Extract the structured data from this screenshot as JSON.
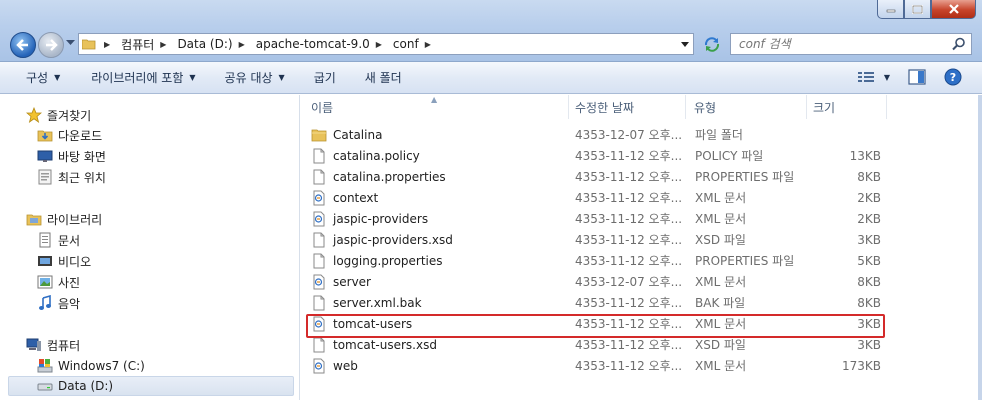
{
  "address": {
    "crumbs": [
      "컴퓨터",
      "Data (D:)",
      "apache-tomcat-9.0",
      "conf"
    ]
  },
  "search": {
    "placeholder": "conf 검색"
  },
  "commands": {
    "organize": "구성",
    "include_library": "라이브러리에 포함",
    "share": "공유 대상",
    "burn": "굽기",
    "new_folder": "새 폴더"
  },
  "nav": {
    "favorites": "즐겨찾기",
    "downloads": "다운로드",
    "desktop": "바탕 화면",
    "recent": "최근 위치",
    "libraries": "라이브러리",
    "documents": "문서",
    "videos": "비디오",
    "pictures": "사진",
    "music": "음악",
    "computer": "컴퓨터",
    "drive_c": "Windows7 (C:)",
    "drive_d": "Data (D:)"
  },
  "columns": {
    "name": "이름",
    "date": "수정한 날짜",
    "type": "유형",
    "size": "크기"
  },
  "files": [
    {
      "name": "Catalina",
      "date": "4353-12-07 오후...",
      "type": "파일 폴더",
      "size": "",
      "icon": "folder-icon"
    },
    {
      "name": "catalina.policy",
      "date": "4353-11-12 오후...",
      "type": "POLICY 파일",
      "size": "13KB",
      "icon": "file-icon"
    },
    {
      "name": "catalina.properties",
      "date": "4353-11-12 오후...",
      "type": "PROPERTIES 파일",
      "size": "8KB",
      "icon": "file-icon"
    },
    {
      "name": "context",
      "date": "4353-11-12 오후...",
      "type": "XML 문서",
      "size": "2KB",
      "icon": "xml-file-icon"
    },
    {
      "name": "jaspic-providers",
      "date": "4353-11-12 오후...",
      "type": "XML 문서",
      "size": "2KB",
      "icon": "xml-file-icon"
    },
    {
      "name": "jaspic-providers.xsd",
      "date": "4353-11-12 오후...",
      "type": "XSD 파일",
      "size": "3KB",
      "icon": "file-icon"
    },
    {
      "name": "logging.properties",
      "date": "4353-11-12 오후...",
      "type": "PROPERTIES 파일",
      "size": "5KB",
      "icon": "file-icon"
    },
    {
      "name": "server",
      "date": "4353-12-07 오후...",
      "type": "XML 문서",
      "size": "8KB",
      "icon": "xml-file-icon"
    },
    {
      "name": "server.xml.bak",
      "date": "4353-11-12 오후...",
      "type": "BAK 파일",
      "size": "8KB",
      "icon": "file-icon"
    },
    {
      "name": "tomcat-users",
      "date": "4353-11-12 오후...",
      "type": "XML 문서",
      "size": "3KB",
      "icon": "xml-file-icon"
    },
    {
      "name": "tomcat-users.xsd",
      "date": "4353-11-12 오후...",
      "type": "XSD 파일",
      "size": "3KB",
      "icon": "file-icon"
    },
    {
      "name": "web",
      "date": "4353-11-12 오후...",
      "type": "XML 문서",
      "size": "173KB",
      "icon": "xml-file-icon"
    }
  ],
  "colors": {
    "highlight": "#d42a2a",
    "folder": "#e8c25a",
    "accent": "#2563b8"
  }
}
